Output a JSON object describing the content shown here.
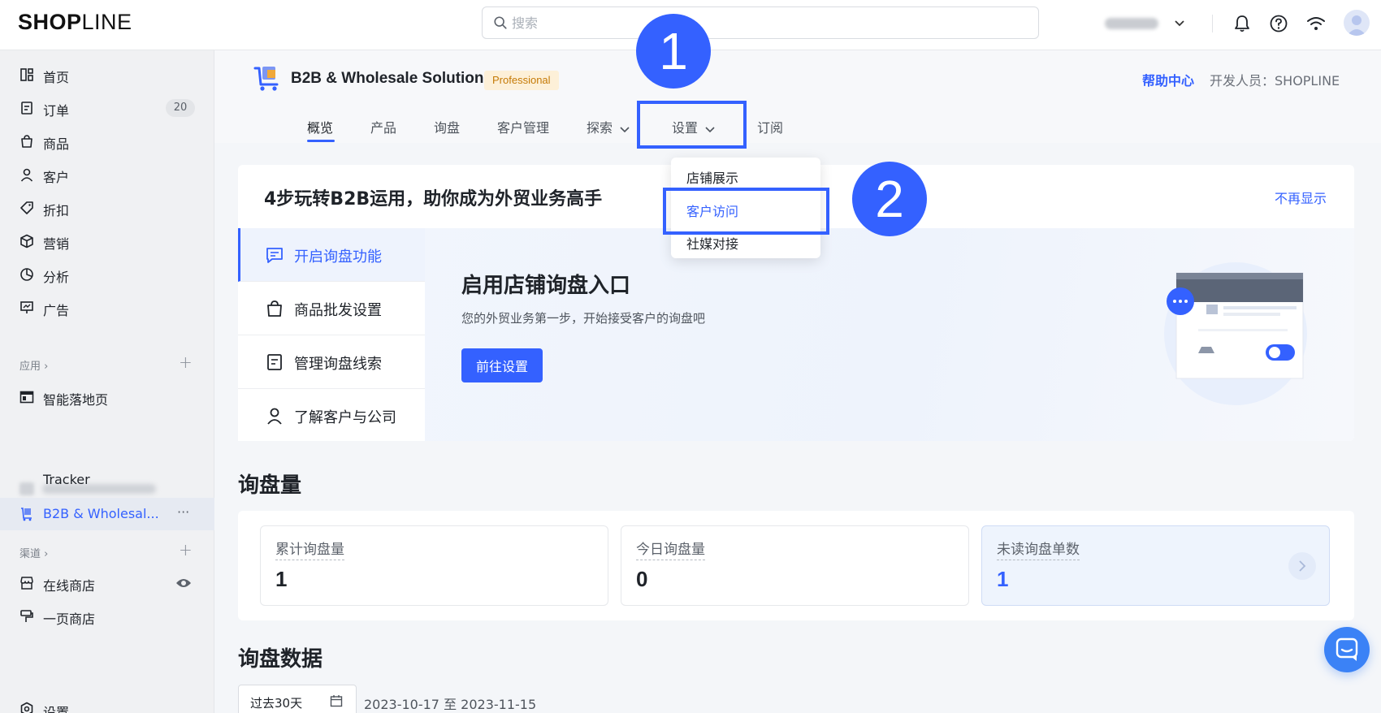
{
  "topbar": {
    "logo_bold": "SHOP",
    "logo_light": "LINE",
    "search_placeholder": "搜索",
    "icons": [
      "bell-icon",
      "help-icon",
      "wifi-icon",
      "avatar"
    ]
  },
  "sidebar": {
    "items": [
      {
        "label": "首页",
        "icon": "dashboard-icon"
      },
      {
        "label": "订单",
        "icon": "order-icon",
        "badge": "20"
      },
      {
        "label": "商品",
        "icon": "bag-icon"
      },
      {
        "label": "客户",
        "icon": "user-icon"
      },
      {
        "label": "折扣",
        "icon": "tag-icon"
      },
      {
        "label": "营销",
        "icon": "cube-icon"
      },
      {
        "label": "分析",
        "icon": "pie-chart-icon"
      },
      {
        "label": "广告",
        "icon": "ad-icon"
      }
    ],
    "apps_title": "应用",
    "apps": [
      {
        "label": "智能落地页",
        "icon": "landing-page-icon"
      },
      {
        "label": "Tracker",
        "icon": "blank"
      },
      {
        "label": "B2B & Wholesal...",
        "icon": "cart-icon",
        "active": true,
        "more": "···"
      }
    ],
    "channels_title": "渠道",
    "channels": [
      {
        "label": "在线商店",
        "icon": "store-icon"
      },
      {
        "label": "一页商店",
        "icon": "brush-icon"
      }
    ],
    "settings_label": "设置"
  },
  "app": {
    "title": "B2B & Wholesale Solution",
    "plan": "Professional",
    "help": "帮助中心",
    "developer": "开发人员：SHOPLINE",
    "tabs": [
      "概览",
      "产品",
      "询盘",
      "客户管理",
      "探索",
      "设置",
      "订阅"
    ]
  },
  "dropdown": {
    "options": [
      "店铺展示",
      "客户访问",
      "社媒对接"
    ],
    "selected": 1
  },
  "annotations": {
    "step1": "1",
    "step2": "2"
  },
  "guide": {
    "title": "4步玩转B2B运用，助你成为外贸业务高手",
    "dismiss": "不再显示",
    "steps": [
      "开启询盘功能",
      "商品批发设置",
      "管理询盘线索",
      "了解客户与公司"
    ],
    "content_title": "启用店铺询盘入口",
    "content_desc": "您的外贸业务第一步，开始接受客户的询盘吧",
    "cta": "前往设置"
  },
  "inquiry_volume": {
    "heading": "询盘量",
    "stats": [
      {
        "name": "累计询盘量",
        "value": "1"
      },
      {
        "name": "今日询盘量",
        "value": "0"
      },
      {
        "name": "未读询盘单数",
        "value": "1"
      }
    ]
  },
  "inquiry_data": {
    "heading": "询盘数据",
    "period": "过去30天",
    "range": "2023-10-17 至 2023-11-15"
  },
  "colors": {
    "accent": "#3461ff",
    "plan_bg": "#fdf0d8",
    "plan_text": "#c57a06"
  }
}
